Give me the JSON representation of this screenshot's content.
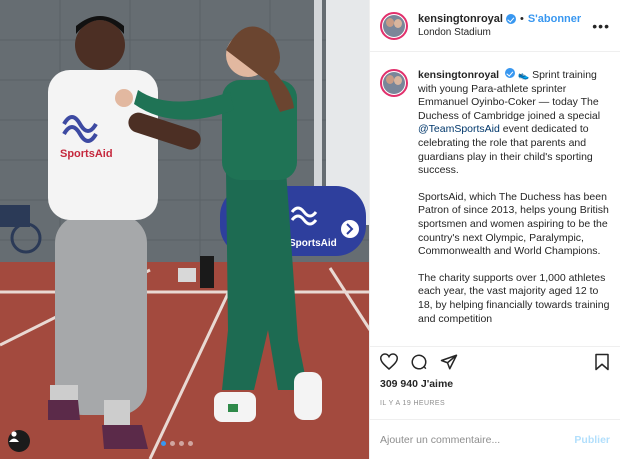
{
  "post": {
    "photo": {
      "banner_text": "SportsAid",
      "shirt_text": "SportsAid",
      "carousel_total": 4,
      "carousel_active": 1
    },
    "header": {
      "username": "kensingtonroyal",
      "separator": "•",
      "follow_label": "S'abonner",
      "location": "London Stadium",
      "more_label": "•••"
    },
    "caption": {
      "username": "kensingtonroyal",
      "emoji": "👟",
      "p1_before": "Sprint training with young Para-athlete sprinter Emmanuel Oyinbo-Coker — today The Duchess of Cambridge joined a special ",
      "mention": "@TeamSportsAid",
      "p1_after": " event dedicated to celebrating the role that parents and guardians play in their child's sporting success.",
      "p2": "SportsAid, which The Duchess has been Patron of since 2013, helps young British sportsmen and women aspiring to be the country's next Olympic, Paralympic, Commonwealth and World Champions.",
      "p3": "The charity supports over 1,000 athletes each year, the vast majority aged 12 to 18, by helping financially towards training and competition"
    },
    "likes": "309 940 J'aime",
    "timestamp": "IL Y A 19 HEURES",
    "comment_input": {
      "placeholder": "Ajouter un commentaire...",
      "value": ""
    },
    "publish_label": "Publier",
    "colors": {
      "accent": "#3897f0",
      "publish_disabled": "#b2dffc",
      "track": "#a34a3e",
      "cardigan": "#1d6b52"
    }
  }
}
